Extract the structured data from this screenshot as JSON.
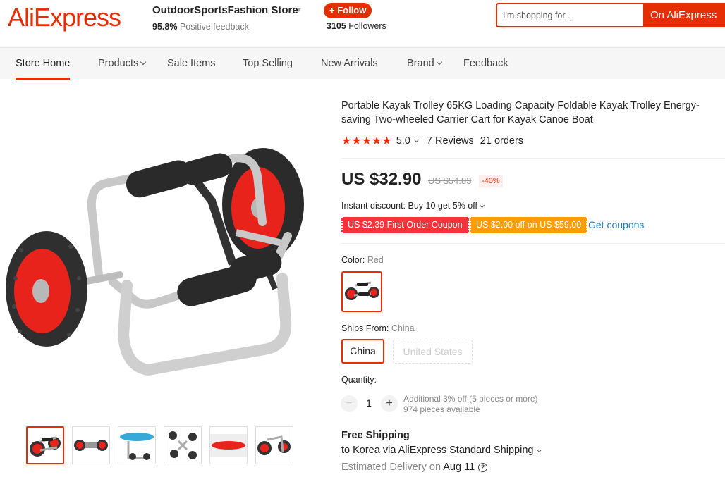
{
  "header": {
    "logo": "AliExpress",
    "store_name": "OutdoorSportsFashion Store",
    "feedback_pct": "95.8%",
    "feedback_label": "Positive feedback",
    "follow_label": "+ Follow",
    "followers_count": "3105",
    "followers_label": "Followers",
    "search_placeholder": "I'm shopping for...",
    "search_button": "On AliExpress"
  },
  "nav": {
    "items": [
      {
        "label": "Store Home",
        "active": true
      },
      {
        "label": "Products",
        "dropdown": true
      },
      {
        "label": "Sale Items"
      },
      {
        "label": "Top Selling"
      },
      {
        "label": "New Arrivals"
      },
      {
        "label": "Brand",
        "dropdown": true
      },
      {
        "label": "Feedback"
      }
    ]
  },
  "product": {
    "title": "Portable Kayak Trolley 65KG Loading Capacity Foldable Kayak Trolley Energy-saving Two-wheeled Carrier Cart for Kayak Canoe Boat",
    "stars": "★★★★★",
    "rating": "5.0",
    "reviews": "7 Reviews",
    "orders": "21 orders",
    "price": "US $32.90",
    "original_price": "US $54.83",
    "discount": "-40%",
    "instant_discount": "Instant discount: Buy 10 get 5% off",
    "coupon_first_order": "US $2.39 First Order Coupon",
    "coupon_threshold": "US $2.00 off on US $59.00",
    "get_coupons": "Get coupons",
    "color_label": "Color:",
    "color_value": "Red",
    "ships_from_label": "Ships From:",
    "ships_from_value": "China",
    "ships_options": [
      "China",
      "United States"
    ],
    "quantity_label": "Quantity:",
    "quantity": "1",
    "qty_minus": "−",
    "qty_plus": "+",
    "qty_note_1": "Additional 3% off (5 pieces or more)",
    "qty_note_2": "974 pieces available",
    "free_shipping": "Free Shipping",
    "ship_to": "to Korea via AliExpress Standard Shipping",
    "delivery_label": "Estimated Delivery on",
    "delivery_date": "Aug 11",
    "help_glyph": "?"
  },
  "colors": {
    "accent": "#e62e04",
    "coupon_red": "#f8323a",
    "coupon_orange": "#ff9c00",
    "link": "#1f7dbc"
  },
  "thumbnails": [
    {
      "icon": "kayak-trolley-red-thumb",
      "selected": true
    },
    {
      "icon": "kayak-trolley-folded-thumb"
    },
    {
      "icon": "kayak-trolley-blue-kayak-thumb"
    },
    {
      "icon": "kayak-trolley-parts-thumb"
    },
    {
      "icon": "kayak-trolley-red-kayak-thumb"
    },
    {
      "icon": "kayak-trolley-side-thumb"
    }
  ]
}
